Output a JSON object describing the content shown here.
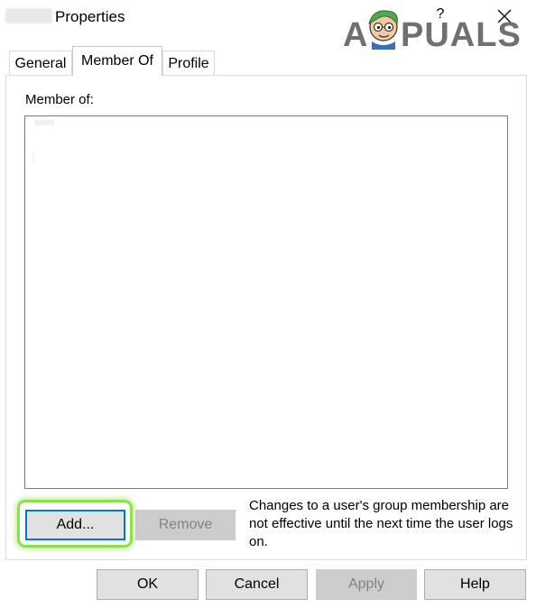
{
  "window": {
    "title": "Properties",
    "help_glyph": "?",
    "close_glyph": "×"
  },
  "logo": {
    "text": "APPUALS",
    "brand_color": "#6b6b6b"
  },
  "tabs": [
    {
      "label": "General",
      "active": false
    },
    {
      "label": "Member Of",
      "active": true
    },
    {
      "label": "Profile",
      "active": false
    }
  ],
  "member_of": {
    "label": "Member of:",
    "items": []
  },
  "actions": {
    "add_label": "Add...",
    "remove_label": "Remove",
    "note": "Changes to a user's group membership are not effective until the next time the user logs on.",
    "highlight_color": "#8ee04a"
  },
  "footer": {
    "ok_label": "OK",
    "cancel_label": "Cancel",
    "apply_label": "Apply",
    "help_label": "Help"
  }
}
